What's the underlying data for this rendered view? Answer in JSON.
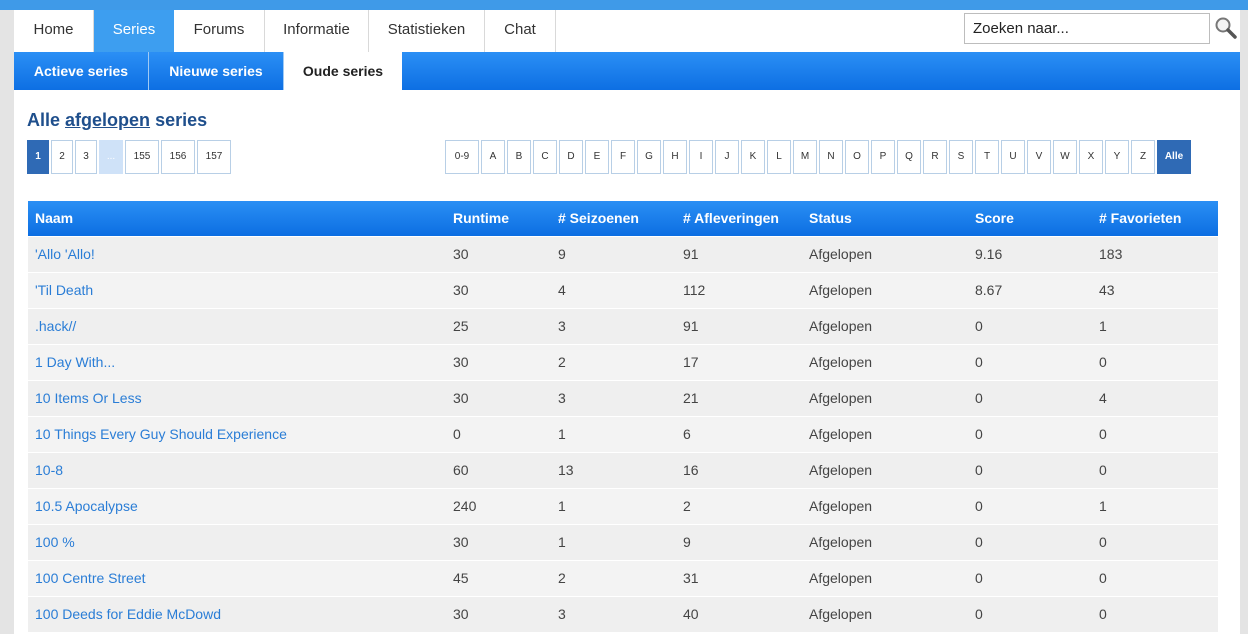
{
  "nav": {
    "tabs": [
      "Home",
      "Series",
      "Forums",
      "Informatie",
      "Statistieken",
      "Chat"
    ],
    "active_tab": "Series"
  },
  "search": {
    "placeholder": "Zoeken naar..."
  },
  "subnav": {
    "tabs": [
      "Actieve series",
      "Nieuwe series",
      "Oude series"
    ],
    "active_tab": "Oude series"
  },
  "heading": {
    "prefix": "Alle",
    "link": "afgelopen",
    "suffix": "series"
  },
  "pagination": {
    "pages": [
      "1",
      "2",
      "3",
      "...",
      "155",
      "156",
      "157"
    ],
    "current": "1"
  },
  "letters": {
    "items": [
      "0-9",
      "A",
      "B",
      "C",
      "D",
      "E",
      "F",
      "G",
      "H",
      "I",
      "J",
      "K",
      "L",
      "M",
      "N",
      "O",
      "P",
      "Q",
      "R",
      "S",
      "T",
      "U",
      "V",
      "W",
      "X",
      "Y",
      "Z",
      "Alle"
    ],
    "current": "Alle"
  },
  "table": {
    "columns": [
      "Naam",
      "Runtime",
      "# Seizoenen",
      "# Afleveringen",
      "Status",
      "Score",
      "# Favorieten"
    ],
    "rows": [
      [
        "'Allo 'Allo!",
        "30",
        "9",
        "91",
        "Afgelopen",
        "9.16",
        "183"
      ],
      [
        "'Til Death",
        "30",
        "4",
        "112",
        "Afgelopen",
        "8.67",
        "43"
      ],
      [
        ".hack//",
        "25",
        "3",
        "91",
        "Afgelopen",
        "0",
        "1"
      ],
      [
        "1 Day With...",
        "30",
        "2",
        "17",
        "Afgelopen",
        "0",
        "0"
      ],
      [
        "10 Items Or Less",
        "30",
        "3",
        "21",
        "Afgelopen",
        "0",
        "4"
      ],
      [
        "10 Things Every Guy Should Experience",
        "0",
        "1",
        "6",
        "Afgelopen",
        "0",
        "0"
      ],
      [
        "10-8",
        "60",
        "13",
        "16",
        "Afgelopen",
        "0",
        "0"
      ],
      [
        "10.5 Apocalypse",
        "240",
        "1",
        "2",
        "Afgelopen",
        "0",
        "1"
      ],
      [
        "100 %",
        "30",
        "1",
        "9",
        "Afgelopen",
        "0",
        "0"
      ],
      [
        "100 Centre Street",
        "45",
        "2",
        "31",
        "Afgelopen",
        "0",
        "0"
      ],
      [
        "100 Deeds for Eddie McDowd",
        "30",
        "3",
        "40",
        "Afgelopen",
        "0",
        "0"
      ]
    ]
  },
  "colors": {
    "accent": "#3d9ef0",
    "heading": "#1f4f8c",
    "link": "#2a7dd6",
    "pager_active": "#2f6ab5"
  }
}
